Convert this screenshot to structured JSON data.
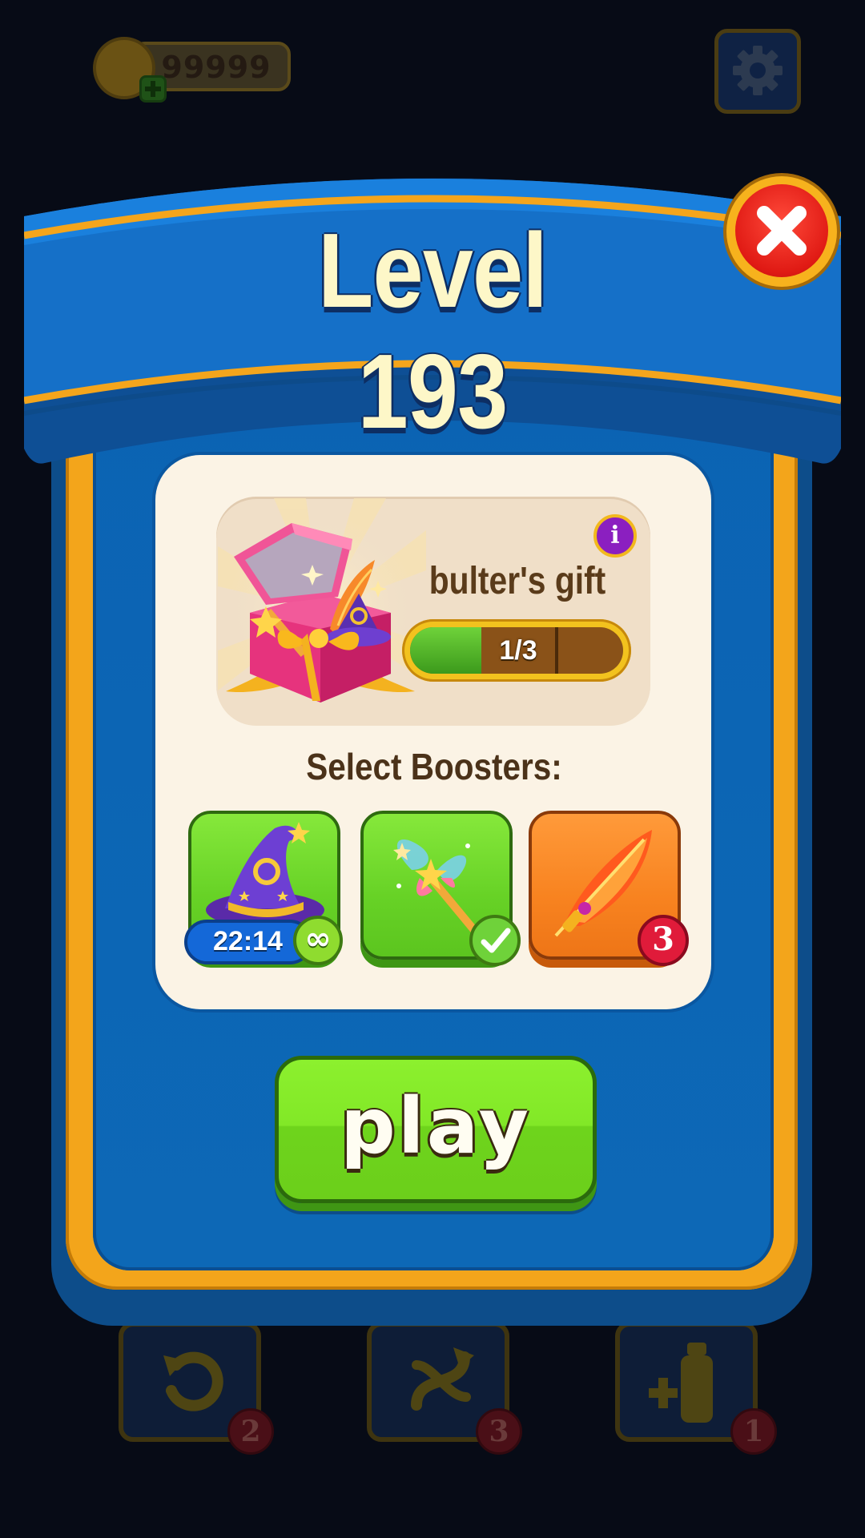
{
  "hud": {
    "coins": "99999",
    "toolbar_badges": [
      "2",
      "3",
      "1"
    ]
  },
  "modal": {
    "title": "Level 193",
    "gift": {
      "title": "bulter's gift",
      "progress_text": "1/3",
      "progress_current": 1,
      "progress_total": 3
    },
    "select_label": "Select Boosters:",
    "boosters": [
      {
        "name": "wizard-hat",
        "timer": "22:14",
        "badge": "∞"
      },
      {
        "name": "magic-wand",
        "selected": true
      },
      {
        "name": "fire-feather",
        "count": "3"
      }
    ],
    "play_label": "play"
  },
  "colors": {
    "panel_blue": "#0b63b3",
    "panel_orange": "#f3a51b",
    "card_bg": "#fbf3e5",
    "play_green": "#82e827",
    "close_red": "#e01a14"
  },
  "icons": [
    "coin-icon",
    "plus-icon",
    "gear-icon",
    "undo-icon",
    "shuffle-icon",
    "bottle-plus-icon",
    "info-icon",
    "close-icon",
    "check-icon",
    "infinity-icon"
  ]
}
